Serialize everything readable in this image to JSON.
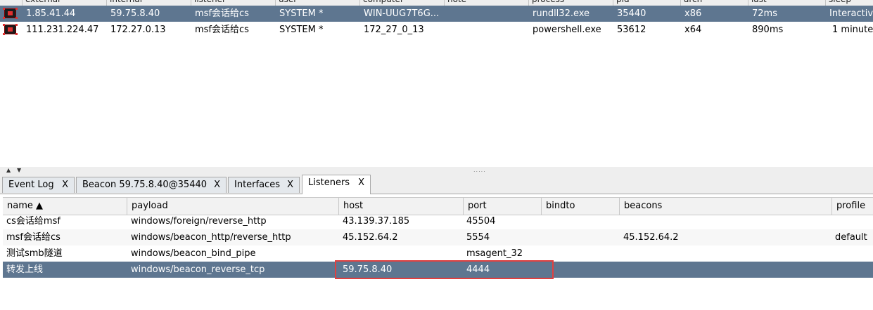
{
  "beacons": {
    "columns": [
      "external",
      "internal",
      "listener",
      "user",
      "computer",
      "note",
      "process",
      "pid",
      "arch",
      "last",
      "sleep"
    ],
    "rows": [
      {
        "external": "1.85.41.44",
        "internal": "59.75.8.40",
        "listener": "msf会话给cs",
        "user": "SYSTEM *",
        "computer": "WIN-UUG7T6G...",
        "note": "",
        "process": "rundll32.exe",
        "pid": "35440",
        "arch": "x86",
        "last": "72ms",
        "sleep": "Interactive"
      },
      {
        "external": "111.231.224.47",
        "internal": "172.27.0.13",
        "listener": "msf会话给cs",
        "user": "SYSTEM *",
        "computer": "172_27_0_13",
        "note": "",
        "process": "powershell.exe",
        "pid": "53612",
        "arch": "x64",
        "last": "890ms",
        "sleep": "1 minute"
      }
    ]
  },
  "splitter": {
    "up": "▲",
    "down": "▼",
    "grip": "....."
  },
  "tabs": [
    {
      "label": "Event Log",
      "close": "X"
    },
    {
      "label": "Beacon 59.75.8.40@35440",
      "close": "X"
    },
    {
      "label": "Interfaces",
      "close": "X"
    },
    {
      "label": "Listeners",
      "close": "X"
    }
  ],
  "listeners": {
    "columns": [
      "name ▲",
      "payload",
      "host",
      "port",
      "bindto",
      "beacons",
      "profile"
    ],
    "rows": [
      {
        "name": "cs会话给msf",
        "payload": "windows/foreign/reverse_http",
        "host": "43.139.37.185",
        "port": "45504",
        "bindto": "",
        "beacons": "",
        "profile": ""
      },
      {
        "name": "msf会话给cs",
        "payload": "windows/beacon_http/reverse_http",
        "host": "45.152.64.2",
        "port": "5554",
        "bindto": "",
        "beacons": "45.152.64.2",
        "profile": "default"
      },
      {
        "name": "测试smb隧道",
        "payload": "windows/beacon_bind_pipe",
        "host": "",
        "port": "msagent_32",
        "bindto": "",
        "beacons": "",
        "profile": ""
      },
      {
        "name": "转发上线",
        "payload": "windows/beacon_reverse_tcp",
        "host": "59.75.8.40",
        "port": "4444",
        "bindto": "",
        "beacons": "",
        "profile": ""
      }
    ]
  },
  "colors": {
    "selection": "#5e7690",
    "highlight_box": "#e04040"
  }
}
